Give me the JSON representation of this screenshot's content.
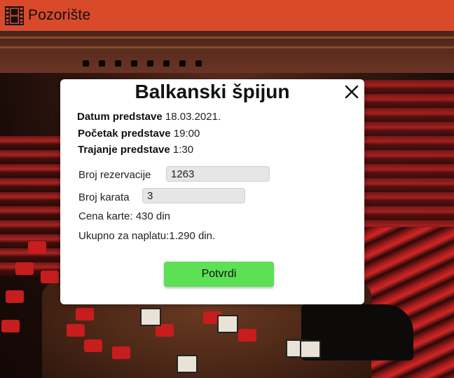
{
  "app": {
    "title": "Pozorište"
  },
  "modal": {
    "title": "Balkanski špijun",
    "date_label": "Datum predstave",
    "date_value": "18.03.2021.",
    "start_label": "Početak predstave",
    "start_value": "19:00",
    "duration_label": "Trajanje predstave",
    "duration_value": "1:30",
    "reservation_label": "Broj rezervacije",
    "reservation_value": "1263",
    "tickets_label": "Broj karata",
    "tickets_value": "3",
    "price_text": "Cena karte: 430 din",
    "total_text": "Ukupno za naplatu:1.290 din.",
    "confirm_label": "Potvrdi"
  },
  "colors": {
    "header": "#d94a2a",
    "confirm_button": "#5ce154"
  },
  "icons": {
    "app": "film-strip-icon",
    "close": "close-icon"
  }
}
